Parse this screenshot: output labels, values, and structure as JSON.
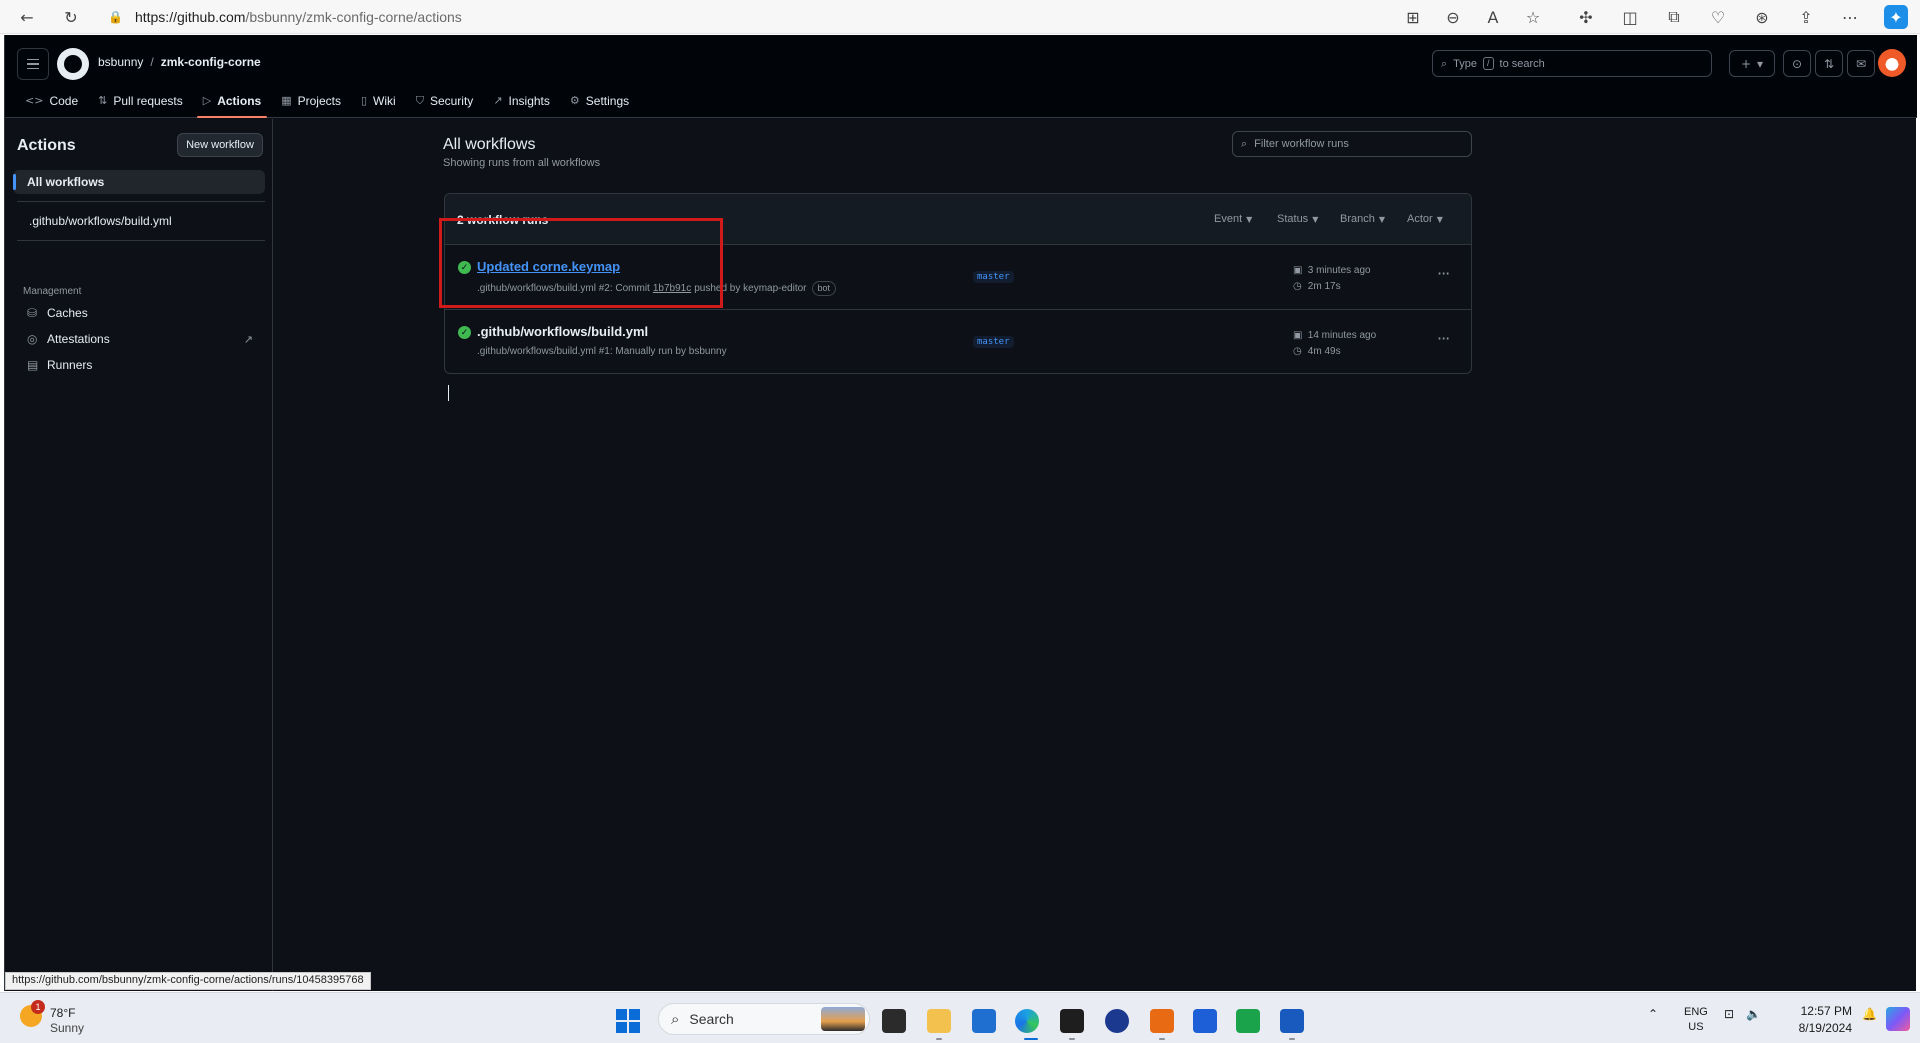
{
  "browser": {
    "url_host": "https://github.com",
    "url_path": "/bsbunny/zmk-config-corne/actions"
  },
  "header": {
    "owner": "bsbunny",
    "separator": "/",
    "repo": "zmk-config-corne",
    "search_prefix": "Type",
    "search_key": "/",
    "search_suffix": "to search",
    "create_icon": "+",
    "caret_icon": "▾"
  },
  "repo_nav": [
    {
      "label": "Code",
      "icon": "<>"
    },
    {
      "label": "Pull requests",
      "icon": "⇅"
    },
    {
      "label": "Actions",
      "icon": "▷"
    },
    {
      "label": "Projects",
      "icon": "▦"
    },
    {
      "label": "Wiki",
      "icon": "▯"
    },
    {
      "label": "Security",
      "icon": "⛉"
    },
    {
      "label": "Insights",
      "icon": "↗"
    },
    {
      "label": "Settings",
      "icon": "⚙"
    }
  ],
  "sidebar": {
    "title": "Actions",
    "new_workflow": "New workflow",
    "all_workflows": "All workflows",
    "workflow_file": ".github/workflows/build.yml",
    "management_heading": "Management",
    "management_items": [
      {
        "label": "Caches",
        "icon": "⛁"
      },
      {
        "label": "Attestations",
        "icon": "◎"
      },
      {
        "label": "Runners",
        "icon": "▤"
      }
    ],
    "external_icon": "↗"
  },
  "main": {
    "title": "All workflows",
    "subtitle": "Showing runs from all workflows",
    "filter_placeholder": "Filter workflow runs",
    "runs_count": "2 workflow runs",
    "filters": [
      "Event",
      "Status",
      "Branch",
      "Actor"
    ],
    "runs": [
      {
        "title": "Updated corne.keymap",
        "meta_prefix": ".github/workflows/build.yml #2: Commit",
        "sha": "1b7b91c",
        "meta_suffix": "pushed by keymap-editor",
        "badge": "bot",
        "branch": "master",
        "when": "3 minutes ago",
        "duration": "2m 17s",
        "status": "success"
      },
      {
        "title": ".github/workflows/build.yml",
        "meta_prefix": ".github/workflows/build.yml #1: Manually run by bsbunny",
        "sha": "",
        "meta_suffix": "",
        "badge": "",
        "branch": "master",
        "when": "14 minutes ago",
        "duration": "4m 49s",
        "status": "success"
      }
    ]
  },
  "status_bar_url": "https://github.com/bsbunny/zmk-config-corne/actions/runs/10458395768",
  "taskbar": {
    "weather_temp": "78°F",
    "weather_desc": "Sunny",
    "weather_badge": "1",
    "search_label": "Search",
    "lang_top": "ENG",
    "lang_bottom": "US",
    "time": "12:57 PM",
    "date": "8/19/2024"
  },
  "colors": {
    "accent_link": "#4493f8",
    "success": "#3fb950",
    "active_tab_underline": "#f78166",
    "highlight": "#d11a1a"
  }
}
